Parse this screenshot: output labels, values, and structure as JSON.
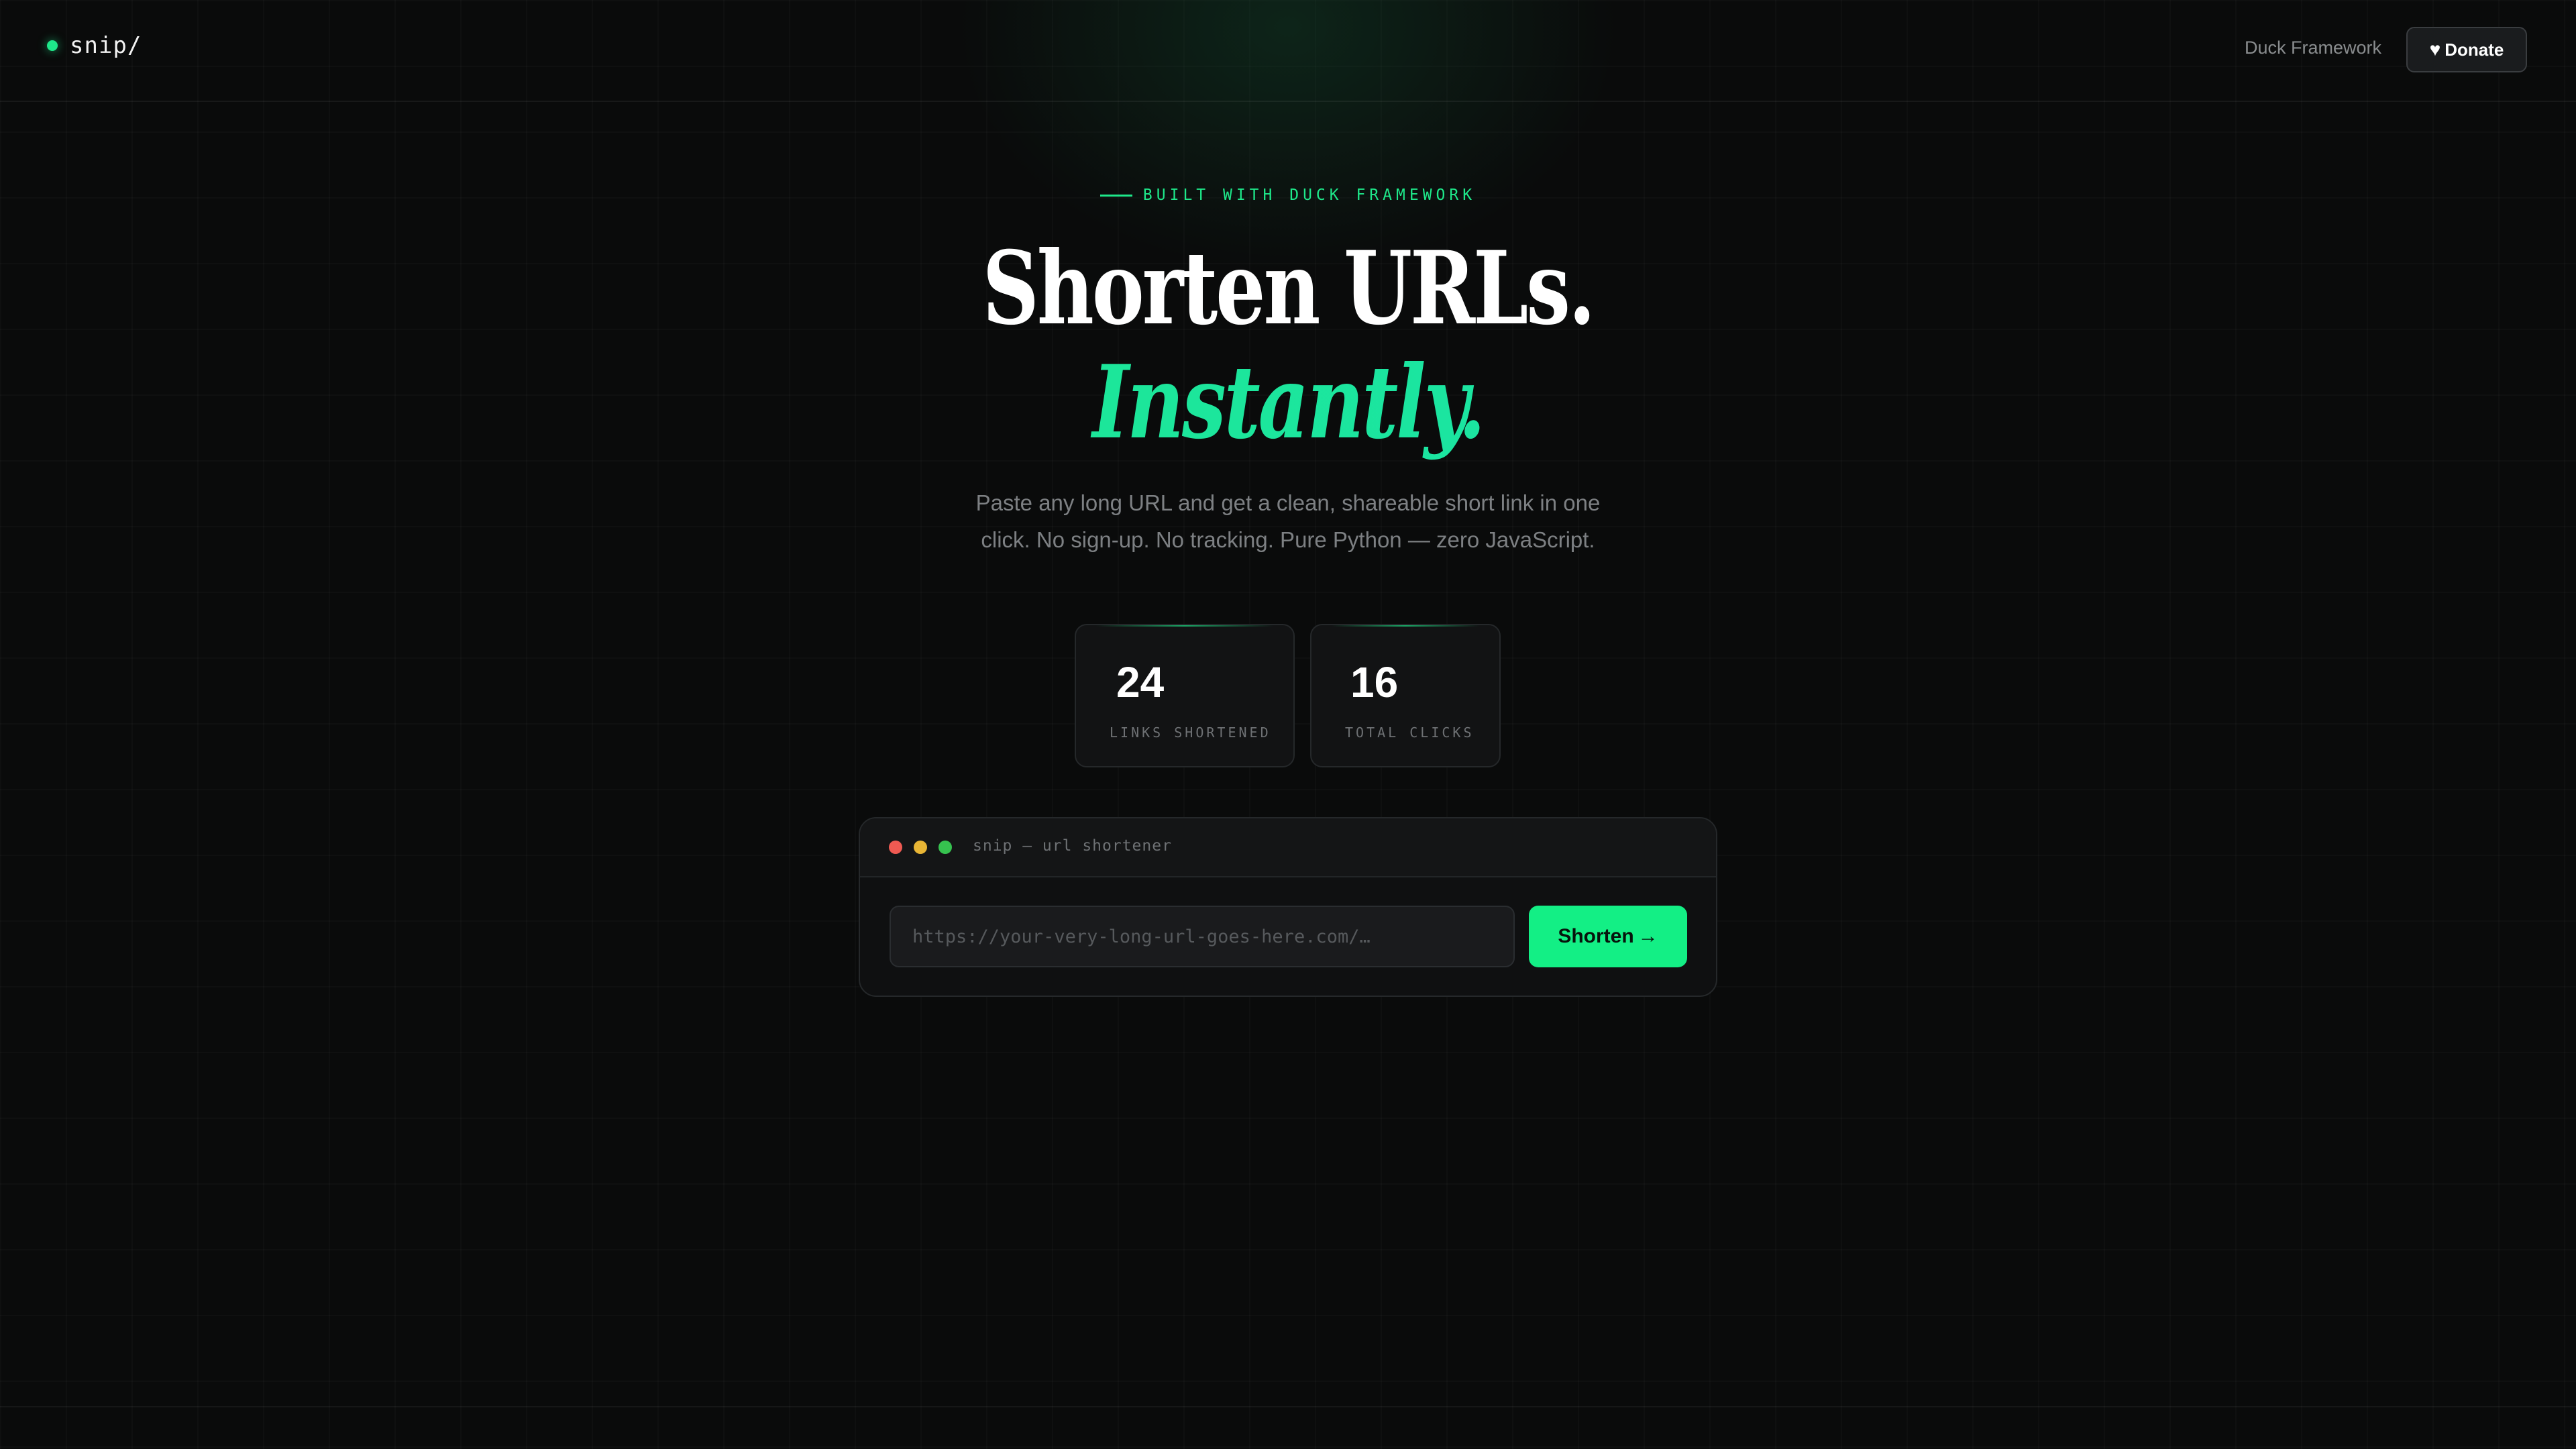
{
  "header": {
    "brand": "snip/",
    "nav_link": "Duck Framework",
    "donate_label": "Donate",
    "donate_icon": "heart-icon"
  },
  "hero": {
    "eyebrow": "BUILT WITH DUCK FRAMEWORK",
    "title_line1": "Shorten URLs.",
    "title_line2": "Instantly.",
    "subtitle": "Paste any long URL and get a clean, shareable short link in one click. No sign-up. No tracking. Pure Python — zero JavaScript."
  },
  "stats": [
    {
      "value": "24",
      "label": "LINKS SHORTENED"
    },
    {
      "value": "16",
      "label": "TOTAL CLICKS"
    }
  ],
  "shortener": {
    "window_title": "snip — url shortener",
    "input_placeholder": "https://your-very-long-url-goes-here.com/…",
    "input_value": "",
    "button_label": "Shorten",
    "button_icon": "arrow-right-icon"
  },
  "colors": {
    "accent": "#1ee88a",
    "button": "#13ef85",
    "background": "#0a0b0b",
    "traffic_red": "#ef5a52",
    "traffic_yellow": "#e8b535",
    "traffic_green": "#36c24f"
  }
}
